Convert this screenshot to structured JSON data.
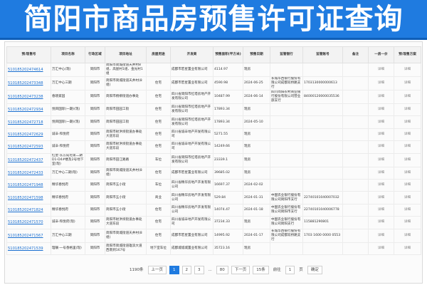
{
  "header": {
    "title": "简阳市商品房预售许可证查询"
  },
  "table": {
    "columns": [
      "预/现售号",
      "项目名称",
      "行政区域",
      "项目地址",
      "房屋用途",
      "开发商",
      "预售面积(平方米)",
      "预售日期",
      "监管银行",
      "监管账号",
      "备注",
      "一房一价",
      "预/现售方案"
    ],
    "rows": [
      {
        "no": "510185202474614",
        "name": "万汇中心(现)",
        "district": "简阳市",
        "address": "简阳市简城街道天井村8组、高屋村1组、金光村1组",
        "use": "",
        "developer": "成都市宏星置业有限公司",
        "area": "4114.97",
        "date": "现房",
        "bank": "",
        "account": "",
        "note": "",
        "price": "详细",
        "plan": "详细"
      },
      {
        "no": "510185202473348",
        "name": "万汇中心三期",
        "district": "简阳市",
        "address": "简阳市简城街道天井村(8组)",
        "use": "住宅",
        "developer": "成都市宏星置业有限公司",
        "area": "4590.98",
        "date": "2024-06-25",
        "bank": "长城华西银行股份有限公司成都双桥路支行",
        "account": "1703130000000613",
        "note": "",
        "price": "详细",
        "plan": "详细"
      },
      {
        "no": "510185202473238",
        "name": "春晓家园",
        "district": "简阳市",
        "address": "简阳市杨柳街道办事处",
        "use": "住宅",
        "developer": "四川省简阳市红塔房地产开发有限公司",
        "area": "10487.99",
        "date": "2024-06-14",
        "bank": "四川简阳农村商业银行股份有限公司营业部支行",
        "account": "84000120000035536",
        "note": "",
        "price": "详细",
        "plan": "详细"
      },
      {
        "no": "510185202472934",
        "name": "悦目国际(一期)(现)",
        "district": "简阳市",
        "address": "简阳市田园工街",
        "use": "住宅",
        "developer": "四川省简阳市红塔房地产开发有限公司",
        "area": "17893.34",
        "date": "现房",
        "bank": "",
        "account": "",
        "note": "",
        "price": "详细",
        "plan": "详细"
      },
      {
        "no": "510185202472718",
        "name": "悦目国际(一期)(现)",
        "district": "简阳市",
        "address": "简阳市田园工街",
        "use": "住宅",
        "developer": "四川省简阳市红塔房地产开发有限公司",
        "area": "17893.34",
        "date": "2024-05-10",
        "bank": "",
        "account": "",
        "note": "",
        "price": "详细",
        "plan": "详细"
      },
      {
        "no": "510185202472629",
        "name": "诚辛·和悦府",
        "district": "简阳市",
        "address": "简阳市射洪坝街道办事处大道东段",
        "use": "住宅",
        "developer": "四川省诚辛地产开发有限公司",
        "area": "5271.55",
        "date": "现房",
        "bank": "",
        "account": "",
        "note": "",
        "price": "详细",
        "plan": "详细"
      },
      {
        "no": "510185202472593",
        "name": "诚辛·和悦府",
        "district": "简阳市",
        "address": "简阳市射洪坝街道办事处大道东段",
        "use": "住宅",
        "developer": "四川省诚辛地产开发有限公司",
        "area": "14249.66",
        "date": "现房",
        "bank": "",
        "account": "",
        "note": "",
        "price": "详细",
        "plan": "详细"
      },
      {
        "no": "510185202472437",
        "name": "红星·东方成宅第二期D1-D4#楼及2号地下室(现)",
        "district": "简阳市",
        "address": "简阳市田江路路",
        "use": "车位",
        "developer": "四川省简阳市红塔房地产开发有限公司",
        "area": "23339.1",
        "date": "现房",
        "bank": "",
        "account": "",
        "note": "",
        "price": "详细",
        "plan": "详细"
      },
      {
        "no": "510185202472433",
        "name": "万汇中心二期(现)",
        "district": "简阳市",
        "address": "简阳市简城街道天井村(8组)",
        "use": "住宅",
        "developer": "成都市宏星置业有限公司",
        "area": "39685.02",
        "date": "现房",
        "bank": "",
        "account": "",
        "note": "",
        "price": "详细",
        "plan": "详细"
      },
      {
        "no": "510185202471948",
        "name": "精华春悦府",
        "district": "简阳市",
        "address": "简阳市五小街",
        "use": "车位",
        "developer": "四川省精华房地产开发有限公司",
        "area": "16697.37",
        "date": "2024-02-02",
        "bank": "",
        "account": "",
        "note": "",
        "price": "详细",
        "plan": "详细"
      },
      {
        "no": "510185202471598",
        "name": "精华春悦府",
        "district": "简阳市",
        "address": "简阳市五小街",
        "use": "商业",
        "developer": "四川省精华房地产开发有限公司",
        "area": "529.84",
        "date": "2024-01-31",
        "bank": "中国农业银行股份有限公司简阳市支行",
        "account": "22740101040007032",
        "note": "",
        "price": "详细",
        "plan": "详细"
      },
      {
        "no": "510185202471824",
        "name": "精华春悦府",
        "district": "简阳市",
        "address": "简阳市五小街",
        "use": "住宅",
        "developer": "四川省精华房地产开发有限公司",
        "area": "14074.47",
        "date": "2024-01-18",
        "bank": "中国农业银行股份有限公司简阳市支行",
        "account": "22740101040006778",
        "note": "",
        "price": "详细",
        "plan": "详细"
      },
      {
        "no": "510185202471570",
        "name": "诚辛·和悦府(现)",
        "district": "简阳市",
        "address": "简阳市射洪坝街道办事处大道东段",
        "use": "住宅",
        "developer": "四川省诚辛地产开发有限公司",
        "area": "37234.33",
        "date": "现房",
        "bank": "中国农业银行股份有限公司简阳支行",
        "account": "115881290801",
        "note": "",
        "price": "详细",
        "plan": "详细"
      },
      {
        "no": "510185202471567",
        "name": "万汇中心三期",
        "district": "简阳市",
        "address": "简阳市简城街道天井村(8组)",
        "use": "住宅",
        "developer": "成都市宏星置业有限公司",
        "area": "14995.92",
        "date": "2024-01-17",
        "bank": "长城华西银行股份有限公司成都双桥路支行",
        "account": "1703 1600 0000 0553",
        "note": "",
        "price": "详细",
        "plan": "详细"
      },
      {
        "no": "510185202471539",
        "name": "理联·一号香格里(现)",
        "district": "简阳市",
        "address": "简阳市简城街道雄滨大道西南到167号",
        "use": "地下室车位",
        "developer": "成都城城城置业有限公司",
        "area": "35723.16",
        "date": "现房",
        "bank": "",
        "account": "",
        "note": "",
        "price": "详细",
        "plan": "详细"
      }
    ]
  },
  "pagination": {
    "total": "1190条",
    "prev": "上一页",
    "pages": [
      "1",
      "2",
      "3",
      "...",
      "80"
    ],
    "active": "1",
    "next": "下一页",
    "page_size": "15条",
    "goto_label": "前往",
    "goto_value": "1",
    "page_suffix": "页",
    "confirm": "确定"
  }
}
